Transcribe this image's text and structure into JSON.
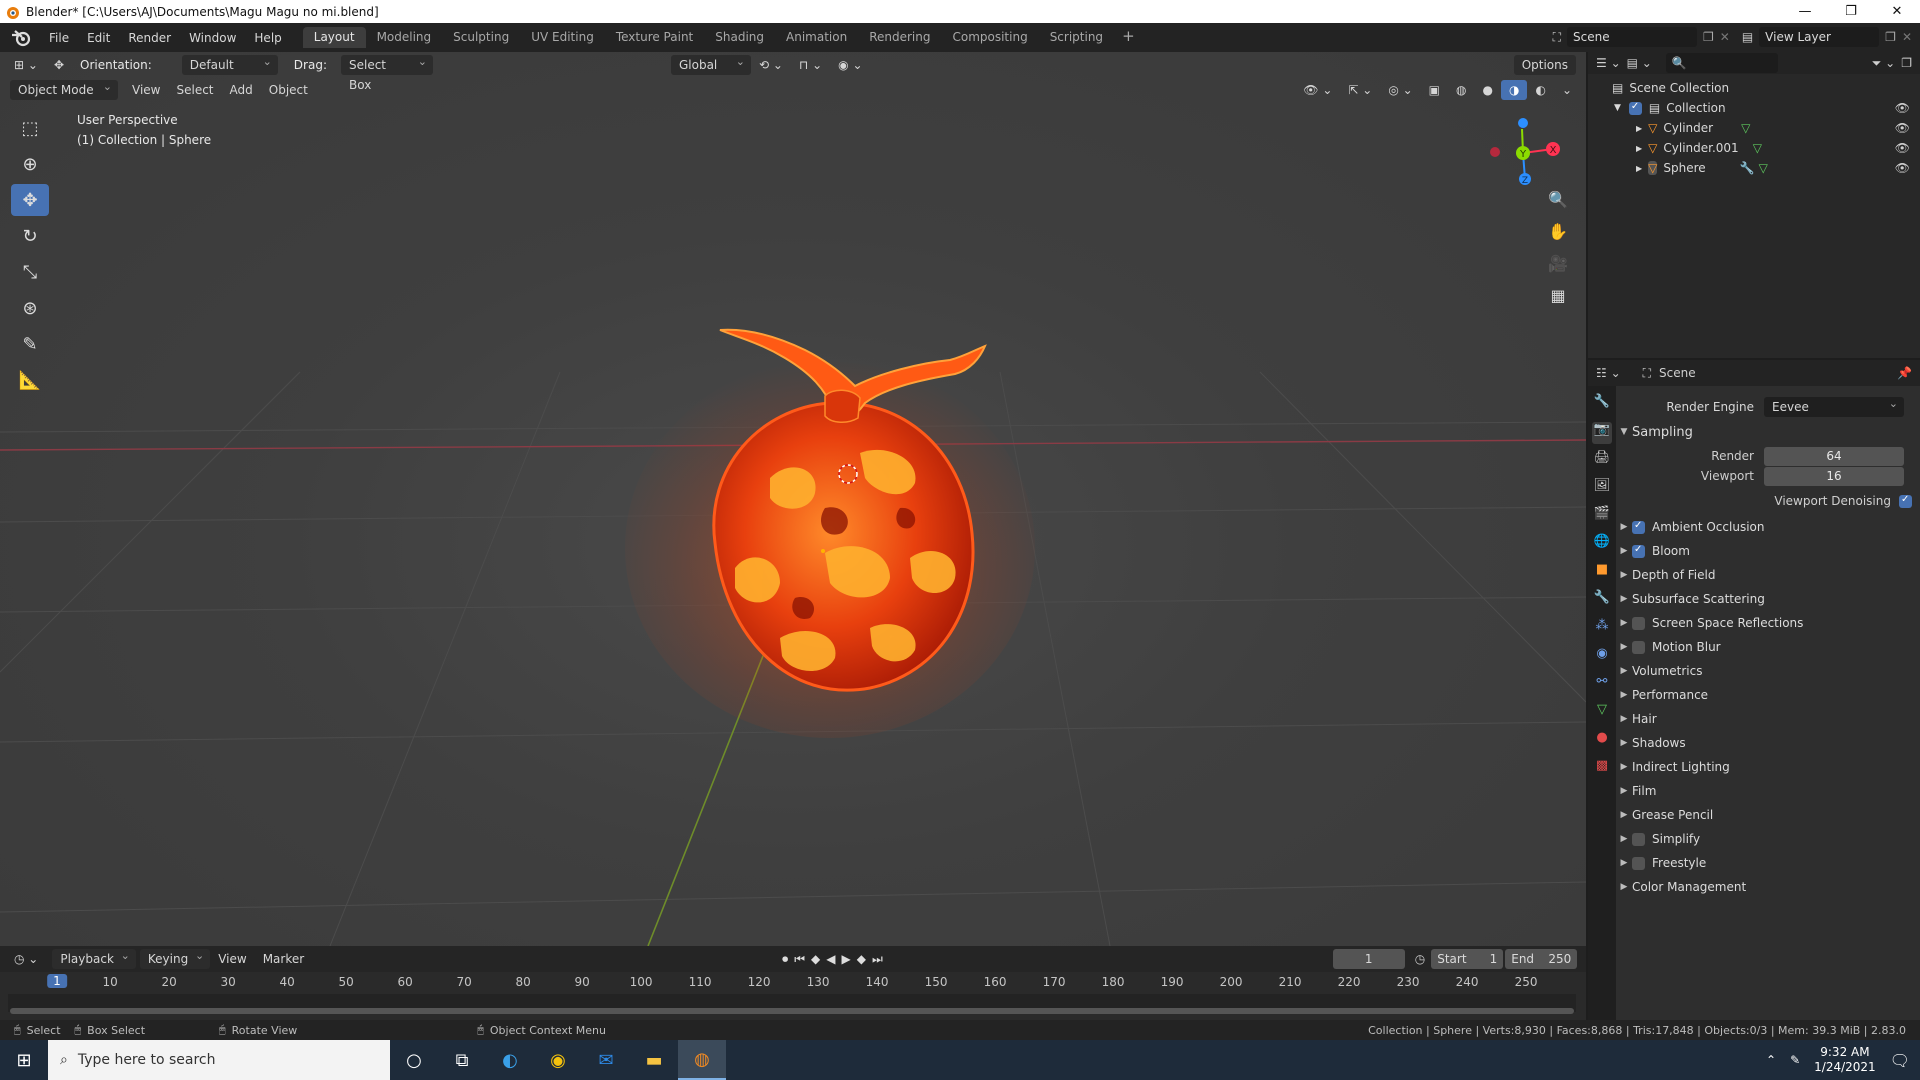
{
  "window": {
    "title": "Blender* [C:\\Users\\AJ\\Documents\\Magu Magu no mi.blend]",
    "minimize": "—",
    "restore": "❐",
    "close": "✕"
  },
  "menubar": {
    "items": [
      "File",
      "Edit",
      "Render",
      "Window",
      "Help"
    ]
  },
  "workspaces": [
    "Layout",
    "Modeling",
    "Sculpting",
    "UV Editing",
    "Texture Paint",
    "Shading",
    "Animation",
    "Rendering",
    "Compositing",
    "Scripting"
  ],
  "workspace_add": "+",
  "scene_selector": {
    "scene": "Scene",
    "view_layer": "View Layer"
  },
  "viewport": {
    "orientation_label": "Orientation:",
    "orientation_value": "Default",
    "drag_label": "Drag:",
    "drag_value": "Select Box",
    "transform_space": "Global",
    "options": "Options",
    "mode": "Object Mode",
    "menus": [
      "View",
      "Select",
      "Add",
      "Object"
    ],
    "perspective": "User Perspective",
    "context": "(1) Collection | Sphere",
    "gizmo": {
      "x": "X",
      "y": "Y",
      "z": "Z"
    }
  },
  "timeline": {
    "menus": [
      "Playback",
      "Keying",
      "View",
      "Marker"
    ],
    "current_frame": "1",
    "start_label": "Start",
    "start": "1",
    "end_label": "End",
    "end": "250",
    "ticks": [
      "1",
      "10",
      "20",
      "30",
      "40",
      "50",
      "60",
      "70",
      "80",
      "90",
      "100",
      "110",
      "120",
      "130",
      "140",
      "150",
      "160",
      "170",
      "180",
      "190",
      "200",
      "210",
      "220",
      "230",
      "240",
      "250"
    ]
  },
  "statusbar": {
    "select": "Select",
    "box_select": "Box Select",
    "rotate_view": "Rotate View",
    "context_menu": "Object Context Menu",
    "stats": "Collection | Sphere | Verts:8,930 | Faces:8,868 | Tris:17,848 | Objects:0/3 | Mem: 39.3 MiB | 2.83.0"
  },
  "outliner": {
    "root": "Scene Collection",
    "collection": "Collection",
    "items": [
      "Cylinder",
      "Cylinder.001",
      "Sphere"
    ]
  },
  "properties": {
    "context": "Scene",
    "render_engine_label": "Render Engine",
    "render_engine": "Eevee",
    "sampling": "Sampling",
    "render_label": "Render",
    "render_value": "64",
    "viewport_label": "Viewport",
    "viewport_value": "16",
    "viewport_denoising": "Viewport Denoising",
    "panels": [
      {
        "label": "Ambient Occlusion",
        "checkbox": "on"
      },
      {
        "label": "Bloom",
        "checkbox": "on"
      },
      {
        "label": "Depth of Field",
        "checkbox": "none"
      },
      {
        "label": "Subsurface Scattering",
        "checkbox": "none"
      },
      {
        "label": "Screen Space Reflections",
        "checkbox": "off"
      },
      {
        "label": "Motion Blur",
        "checkbox": "off"
      },
      {
        "label": "Volumetrics",
        "checkbox": "none"
      },
      {
        "label": "Performance",
        "checkbox": "none"
      },
      {
        "label": "Hair",
        "checkbox": "none"
      },
      {
        "label": "Shadows",
        "checkbox": "none"
      },
      {
        "label": "Indirect Lighting",
        "checkbox": "none"
      },
      {
        "label": "Film",
        "checkbox": "none"
      },
      {
        "label": "Grease Pencil",
        "checkbox": "none"
      },
      {
        "label": "Simplify",
        "checkbox": "off"
      },
      {
        "label": "Freestyle",
        "checkbox": "off"
      },
      {
        "label": "Color Management",
        "checkbox": "none"
      }
    ]
  },
  "taskbar": {
    "search_placeholder": "Type here to search",
    "time": "9:32 AM",
    "date": "1/24/2021"
  },
  "colors": {
    "accent": "#4772b3",
    "fruit_core": "#ff6a1a",
    "fruit_dark": "#a81a05",
    "x_axis": "#ff3352",
    "y_axis": "#8bdc00",
    "z_axis": "#2c8fff"
  }
}
